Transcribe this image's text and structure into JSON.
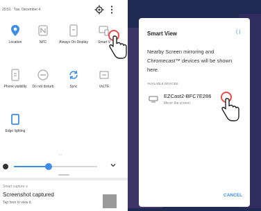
{
  "left": {
    "status_time": "20:51 · Tue, December 4",
    "tiles": [
      {
        "id": "location",
        "label": "Location"
      },
      {
        "id": "nfc",
        "label": "NFC"
      },
      {
        "id": "always-on-display",
        "label": "Always On Display"
      },
      {
        "id": "smart-view",
        "label": "Smart V"
      },
      {
        "id": "phone-visibility",
        "label": "Phone visibility"
      },
      {
        "id": "do-not-disturb",
        "label": "Do not disturb"
      },
      {
        "id": "sync",
        "label": "Sync"
      },
      {
        "id": "volte",
        "label": "VoLTE"
      },
      {
        "id": "edge-lighting",
        "label": "Edge lighting"
      }
    ],
    "page_indicator": "• ○",
    "notification": {
      "app": "Smart capture ∨",
      "title": "Screenshot captured",
      "subtitle": "Tap here to view it."
    }
  },
  "dialog": {
    "title": "Smart View",
    "refresh_label": "( )",
    "description": "Nearby Screen mirroring and Chromecast™ devices will be shown here.",
    "section_label": "AVAILABLE DEVICES",
    "device_name": "EZCast2-BFC7E286",
    "device_subtitle": "Mirror the screen.",
    "cancel_label": "CANCEL"
  },
  "colors": {
    "accent": "#3d8ee8",
    "highlight_ring": "#e84a4a",
    "wallpaper": "#1f2a52"
  },
  "brightness_level": 0.42
}
